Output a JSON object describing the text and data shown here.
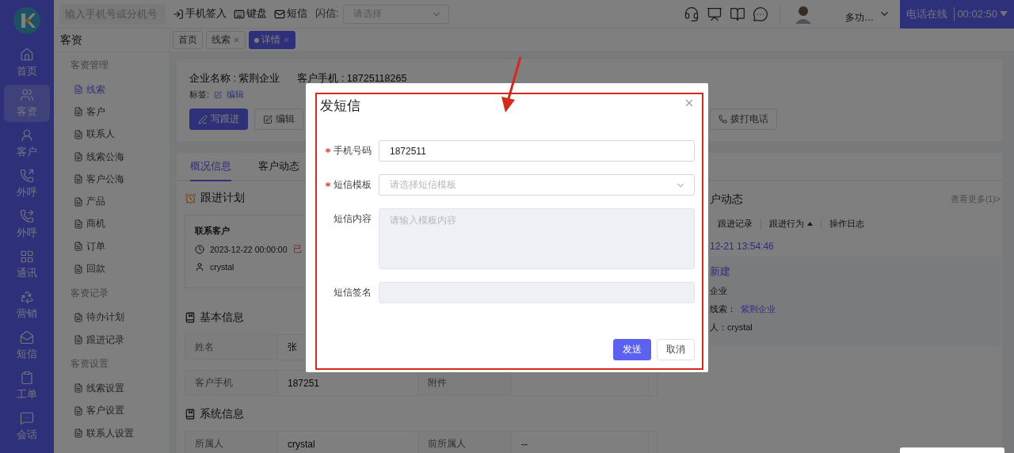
{
  "rail": {
    "items": [
      {
        "label": "首页",
        "selected": false
      },
      {
        "label": "客资",
        "selected": true
      },
      {
        "label": "客户",
        "selected": false
      },
      {
        "label": "外呼",
        "selected": false
      },
      {
        "label": "外呼",
        "selected": false
      },
      {
        "label": "通讯",
        "selected": false
      },
      {
        "label": "营销",
        "selected": false
      },
      {
        "label": "短信",
        "selected": false
      },
      {
        "label": "工单",
        "selected": false
      },
      {
        "label": "会话",
        "selected": false
      }
    ]
  },
  "topbar": {
    "search": {
      "placeholder": "输入手机号或分机号"
    },
    "actions": [
      "手机签入",
      "键盘",
      "短信"
    ],
    "flash": {
      "label": "闪信:",
      "placeholder": "请选择"
    },
    "user": {
      "subtitle": "多功…"
    },
    "phone_status": {
      "status": "电话在线",
      "timer": "00:02:50"
    }
  },
  "sidebar": {
    "title": "客资",
    "groups": [
      {
        "title": "客资管理",
        "items": [
          {
            "label": "线索",
            "selected": true
          },
          {
            "label": "客户",
            "selected": false
          },
          {
            "label": "联系人",
            "selected": false
          },
          {
            "label": "线索公海",
            "selected": false
          },
          {
            "label": "客户公海",
            "selected": false
          },
          {
            "label": "产品",
            "selected": false
          },
          {
            "label": "商机",
            "selected": false
          },
          {
            "label": "订单",
            "selected": false
          },
          {
            "label": "回款",
            "selected": false
          }
        ]
      },
      {
        "title": "客资记录",
        "items": [
          {
            "label": "待办计划",
            "selected": false
          },
          {
            "label": "跟进记录",
            "selected": false
          }
        ]
      },
      {
        "title": "客资设置",
        "items": [
          {
            "label": "线索设置",
            "selected": false
          },
          {
            "label": "客户设置",
            "selected": false
          },
          {
            "label": "联系人设置",
            "selected": false
          }
        ]
      }
    ]
  },
  "page_tabs": [
    {
      "label": "首页",
      "closable": false,
      "selected": false
    },
    {
      "label": "线索",
      "closable": true,
      "selected": false
    },
    {
      "label": "详情",
      "closable": true,
      "selected": true
    }
  ],
  "summary": {
    "fields": [
      "企业名称 : 紫荆企业",
      "客户手机 : 18725118265"
    ],
    "tags_label": "标签:",
    "tags_edit": "编辑",
    "buttons": [
      {
        "label": "写跟进",
        "kind": "primary"
      },
      {
        "label": "编辑",
        "kind": "default"
      }
    ],
    "call_button": "拨打电话"
  },
  "detail_tabs": [
    {
      "label": "概况信息",
      "selected": true
    },
    {
      "label": "客户动态",
      "selected": false
    }
  ],
  "plan": {
    "title": "跟进计划",
    "task": "联系客户",
    "time": "2023-12-22 00:00:00",
    "status": "已",
    "owner": "crystal"
  },
  "sections": [
    {
      "title": "基本信息",
      "rows": [
        [
          "姓名",
          "张"
        ],
        [
          "客户手机",
          "187251",
          "附件"
        ]
      ]
    },
    {
      "title": "系统信息",
      "rows": [
        [
          "所属人",
          "crystal",
          "前所属人",
          "--"
        ]
      ]
    }
  ],
  "activity": {
    "title": "户动态",
    "more": "查看更多(1)>",
    "filters": [
      {
        "label": "跟进记录",
        "sorted": false
      },
      {
        "label": "跟进行为",
        "sorted": true
      },
      {
        "label": "操作日志",
        "sorted": false
      }
    ],
    "time": "12-21 13:54:46",
    "entry": {
      "title": "新建",
      "lines": [
        {
          "text": "企业"
        },
        {
          "text": "线索：",
          "link": "紫荆企业"
        },
        {
          "text": "人：crystal"
        }
      ]
    }
  },
  "modal": {
    "title": "发短信",
    "fields": [
      {
        "label": "手机号码",
        "required": true,
        "kind": "input",
        "value": "1872511",
        "disabled": false
      },
      {
        "label": "短信模板",
        "required": true,
        "kind": "select",
        "placeholder": "请选择短信模板",
        "disabled": false
      },
      {
        "label": "短信内容",
        "required": false,
        "kind": "textarea",
        "placeholder": "请输入模板内容",
        "disabled": true
      },
      {
        "label": "短信签名",
        "required": false,
        "kind": "input",
        "disabled": true
      }
    ],
    "buttons": [
      {
        "label": "发送",
        "kind": "primary"
      },
      {
        "label": "取消",
        "kind": "default"
      }
    ]
  }
}
